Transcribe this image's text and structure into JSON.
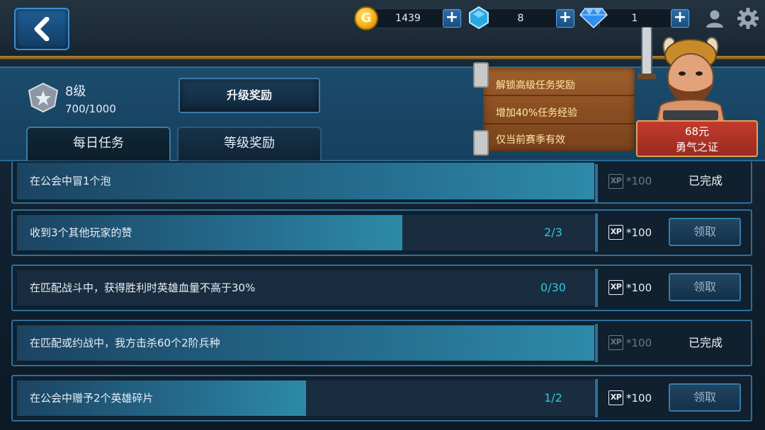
{
  "currency": {
    "gold": "1439",
    "crystal": "8",
    "diamond": "1",
    "plus_label": "+"
  },
  "coin_glyph": "G",
  "header": {
    "level": "8级",
    "xp": "700/1000",
    "upgrade_button": "升级奖励",
    "tabs": [
      "每日任务",
      "等级奖励"
    ],
    "active_tab": 0
  },
  "promo": {
    "lines": [
      "解锁高级任务奖励",
      "增加40%任务经验",
      "仅当前赛季有效"
    ],
    "price": "68元",
    "name": "勇气之证"
  },
  "xp_badge_label": "XP",
  "tasks": [
    {
      "label": "在公会中冒1个泡",
      "progress": "",
      "fill": 1.0,
      "reward": "*100",
      "status": "已完成",
      "completed": true
    },
    {
      "label": "收到3个其他玩家的赞",
      "progress": "2/3",
      "fill": 0.667,
      "reward": "*100",
      "status": "领取",
      "completed": false
    },
    {
      "label": "在匹配战斗中，获得胜利时英雄血量不高于30%",
      "progress": "0/30",
      "fill": 0.0,
      "reward": "*100",
      "status": "领取",
      "completed": false
    },
    {
      "label": "在匹配或约战中，我方击杀60个2阶兵种",
      "progress": "",
      "fill": 1.0,
      "reward": "*100",
      "status": "已完成",
      "completed": true
    },
    {
      "label": "在公会中赠予2个英雄碎片",
      "progress": "1/2",
      "fill": 0.5,
      "reward": "*100",
      "status": "领取",
      "completed": false
    }
  ],
  "colors": {
    "accent_border": "#2f6f9c",
    "progress_text": "#32c7d8",
    "bar_fill_end": "#2d8aa8",
    "gold": "#f4b21a",
    "ribbon_red": "#c33a2d"
  },
  "icons": [
    "back-arrow-icon",
    "coin-icon",
    "crystal-icon",
    "diamond-icon",
    "profile-icon",
    "gear-icon",
    "rank-badge-icon",
    "xp-badge-icon"
  ]
}
